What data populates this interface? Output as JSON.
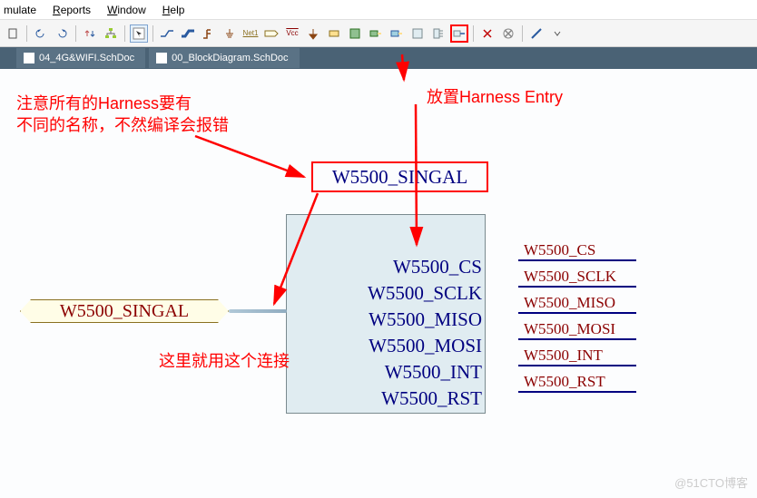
{
  "menu": {
    "simulate": "mulate",
    "reports": "Reports",
    "window": "Window",
    "help": "Help"
  },
  "tabs": {
    "t1": "04_4G&WIFI.SchDoc",
    "t2": "00_BlockDiagram.SchDoc"
  },
  "annotations": {
    "note1_line1": "注意所有的Harness要有",
    "note1_line2": "不同的名称，不然编译会报错",
    "note2": "放置Harness Entry",
    "note3": "这里就用这个连接"
  },
  "harness": {
    "label": "W5500_SINGAL",
    "entries": [
      "W5500_CS",
      "W5500_SCLK",
      "W5500_MISO",
      "W5500_MOSI",
      "W5500_INT",
      "W5500_RST"
    ]
  },
  "nets": [
    "W5500_CS",
    "W5500_SCLK",
    "W5500_MISO",
    "W5500_MOSI",
    "W5500_INT",
    "W5500_RST"
  ],
  "port": {
    "label": "W5500_SINGAL"
  },
  "watermark": "@51CTO博客"
}
